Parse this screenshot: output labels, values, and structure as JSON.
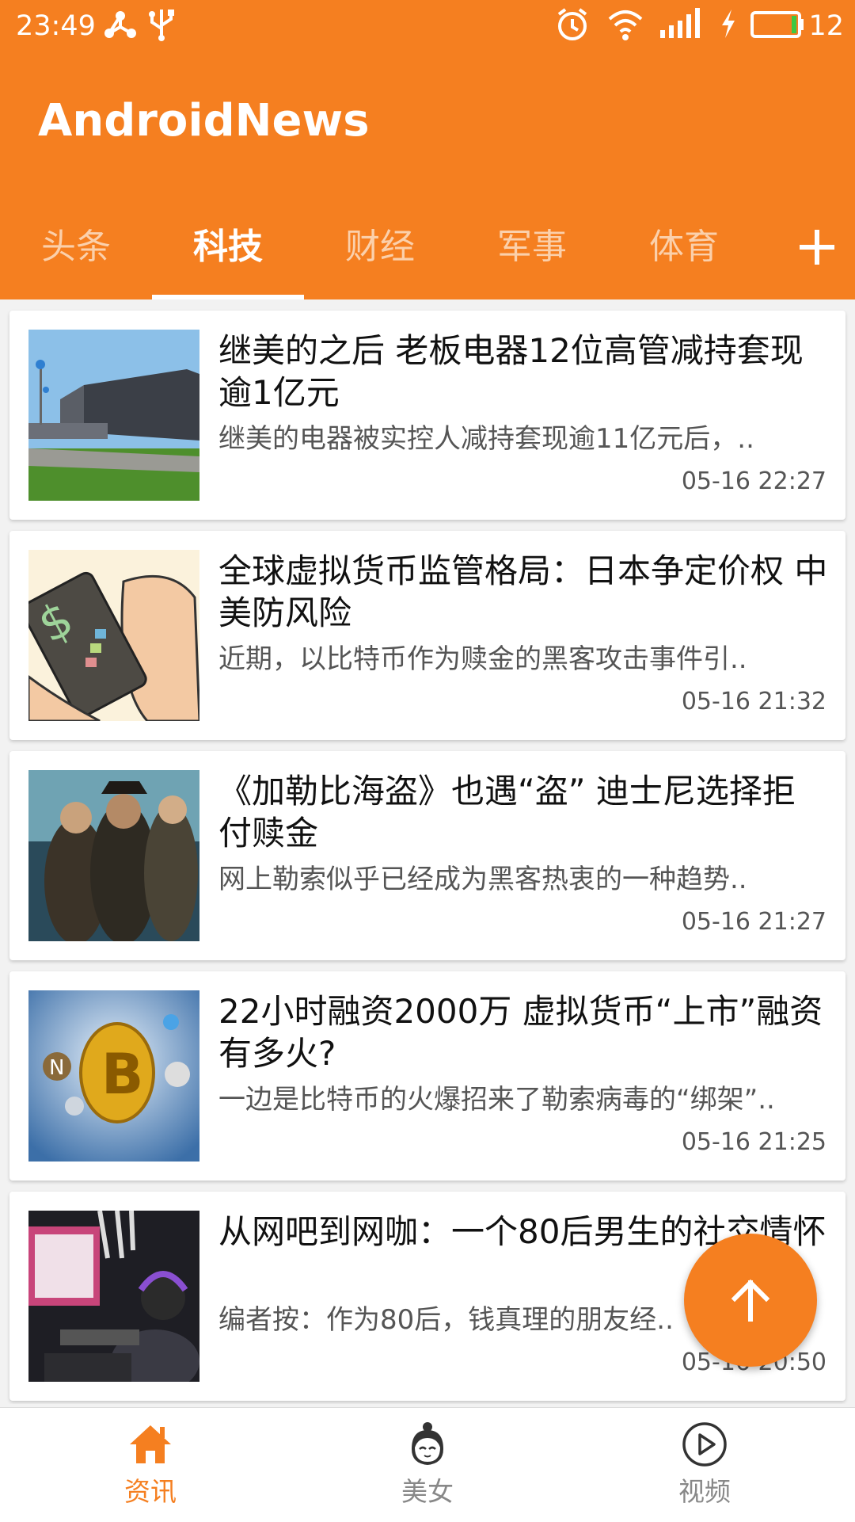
{
  "status_bar": {
    "time": "23:49",
    "battery_level": "12"
  },
  "app": {
    "title": "AndroidNews"
  },
  "tabs": [
    {
      "label": "头条",
      "active": false
    },
    {
      "label": "科技",
      "active": true
    },
    {
      "label": "财经",
      "active": false
    },
    {
      "label": "军事",
      "active": false
    },
    {
      "label": "体育",
      "active": false
    }
  ],
  "news": [
    {
      "title": "继美的之后 老板电器12位高管减持套现逾1亿元",
      "summary": "继美的电器被实控人减持套现逾11亿元后，..",
      "time": "05-16 22:27"
    },
    {
      "title": "全球虚拟货币监管格局：日本争定价权 中美防风险",
      "summary": "近期，以比特币作为赎金的黑客攻击事件引..",
      "time": "05-16 21:32"
    },
    {
      "title": "《加勒比海盗》也遇“盗” 迪士尼选择拒付赎金",
      "summary": "网上勒索似乎已经成为黑客热衷的一种趋势..",
      "time": "05-16 21:27"
    },
    {
      "title": "22小时融资2000万 虚拟货币“上市”融资有多火?",
      "summary": "一边是比特币的火爆招来了勒索病毒的“绑架”..",
      "time": "05-16 21:25"
    },
    {
      "title": "从网吧到网咖：一个80后男生的社交情怀",
      "summary": "编者按：作为80后，钱真理的朋友经..",
      "time": "05-16 20:50"
    }
  ],
  "bottom_nav": [
    {
      "label": "资讯",
      "icon": "home-icon",
      "active": true
    },
    {
      "label": "美女",
      "icon": "girl-face-icon",
      "active": false
    },
    {
      "label": "视频",
      "icon": "play-circle-icon",
      "active": false
    }
  ],
  "colors": {
    "primary": "#f57f20",
    "tab_inactive": "#fbd0ab",
    "nav_inactive": "#888888"
  }
}
